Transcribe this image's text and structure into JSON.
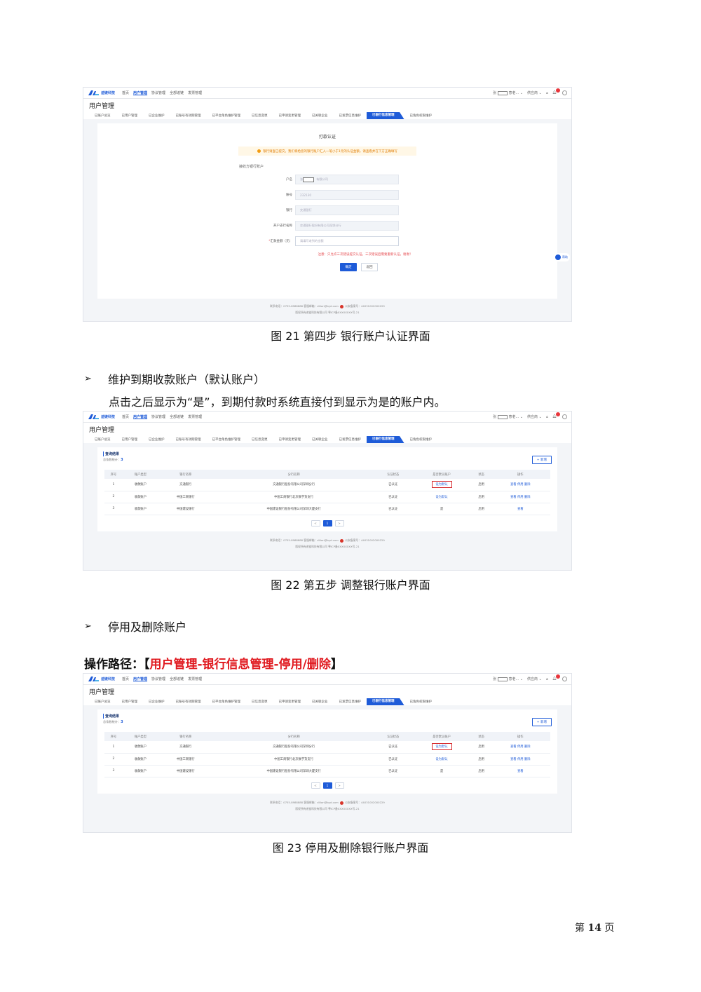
{
  "app": {
    "brand": "迪链科技",
    "nav": [
      "首页",
      "用户管理",
      "协议管理",
      "全部追链",
      "发票管理"
    ],
    "nav_active": "用户管理",
    "user_prefix": "张",
    "user_suffix": "意老...",
    "role": "供应商",
    "notif_count": "9",
    "page_title": "用户管理",
    "tabs": [
      "已账户总览",
      "已用户管理",
      "已企业维护",
      "已账号有效期管理",
      "已平台角色维护管理",
      "已信息变更",
      "已申请变更管理",
      "已关联企业",
      "已发票信息维护",
      "已银行信息管理",
      "已角色权限维护"
    ],
    "tab_active": "已银行信息管理",
    "footer_line1_a": "联系电话：0755-8988888  客服邮箱：dilian@byd.com",
    "footer_line1_b": "公安备案号：44031002000229",
    "footer_line2": "版权所有迪链科技有限公司  粤ICP备XXXXXXXX号-21"
  },
  "fig21": {
    "form_title": "打款认证",
    "notice": "银行请查已提交。我们将给您的银行账户汇入一笔小于1元的认证金额，请查看并在下方正确填写",
    "section_label": "接收方银行账户",
    "fields": [
      {
        "label": "户名",
        "value": "有限公司"
      },
      {
        "label": "账号",
        "value": "232130"
      },
      {
        "label": "银行",
        "value": "交通银行"
      },
      {
        "label": "开户支行名称",
        "value": "交通银行股份有限公司深圳分行"
      },
      {
        "label": "汇款金额（元）",
        "placeholder": "请填写收到的金额"
      }
    ],
    "warning": "注意：只允许三次错误提交认证，三次错误后需要重新认证，谢谢！",
    "confirm": "确定",
    "back": "返回",
    "float_label": "帮助",
    "caption": "图 21 第四步 银行账户认证界面"
  },
  "bullet1": "维护到期收款账户（默认账户）",
  "para1": "点击之后显示为“是”，到期付款时系统直接付到显示为是的账户内。",
  "table": {
    "result_title": "查询结果",
    "count_label": "总条数统计：",
    "count": "3",
    "add_btn": "+ 新增",
    "headers": [
      "序号",
      "账户类型",
      "银行名称",
      "分行名称",
      "认证状态",
      "是否默认账户",
      "状态",
      "操作"
    ],
    "rows": [
      {
        "no": "1",
        "type": "收款账户",
        "bank": "交通银行",
        "branch": "交通银行股份有限公司深圳分行",
        "auth": "已认证",
        "default": "设为默认",
        "status": "启用",
        "ops": "查看 停用 删除"
      },
      {
        "no": "2",
        "type": "收款账户",
        "bank": "中国工商银行",
        "branch": "中国工商银行北京数字货支行",
        "auth": "已认证",
        "default": "设为默认",
        "status": "启用",
        "ops": "查看 停用 删除"
      },
      {
        "no": "3",
        "type": "收款账户",
        "bank": "中国建设银行",
        "branch": "中国建设银行股份有限公司深圳大厦支行",
        "auth": "已认证",
        "default": "是",
        "status": "启用",
        "ops": "查看"
      }
    ],
    "pager": [
      "<",
      "1",
      ">"
    ]
  },
  "fig22_caption": "图 22 第五步 调整银行账户界面",
  "bullet2": "停用及删除账户",
  "path_prefix": "操作路径：",
  "path_open": "【",
  "path_red": "用户管理-银行信息管理-停用/删除",
  "path_close": "】",
  "fig23_caption": "图 23 停用及删除银行账户界面",
  "page_number": {
    "prefix": "第",
    "num": "14",
    "suffix": "页"
  }
}
